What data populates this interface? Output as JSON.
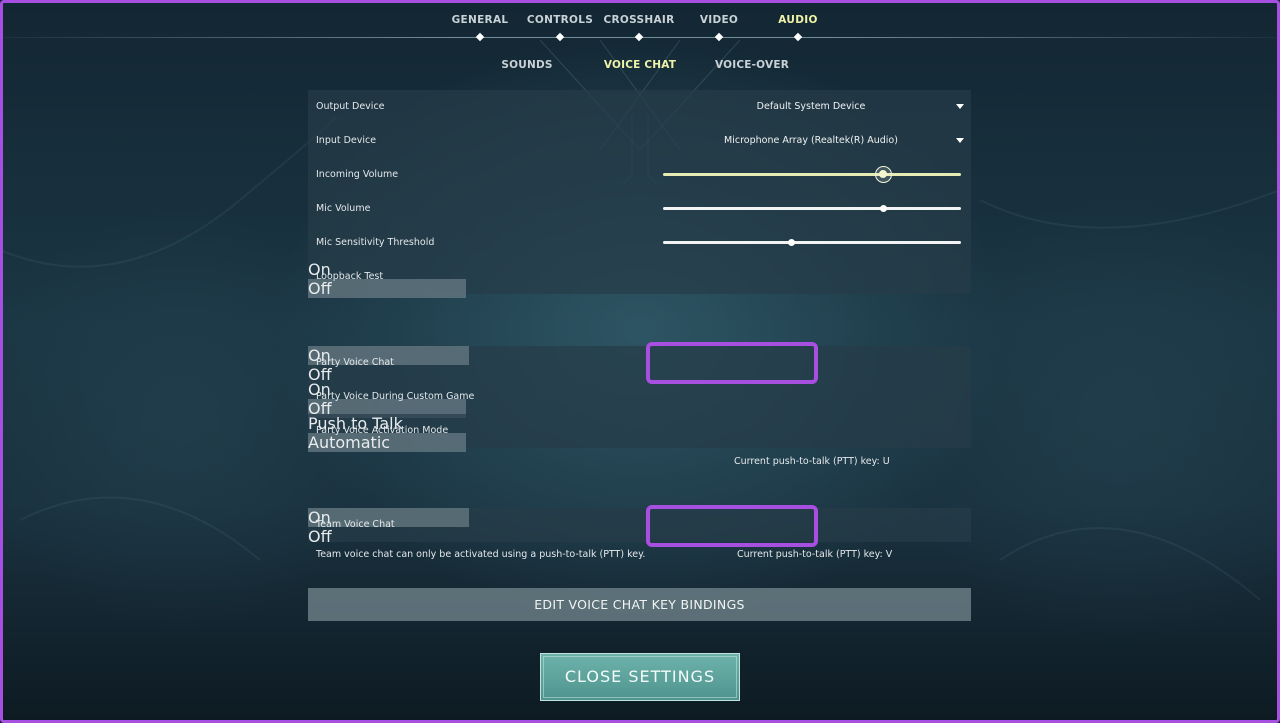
{
  "colors": {
    "accent": "#eef3a8",
    "highlight": "#a64fe0",
    "close_button": "#5fa49d"
  },
  "top_tabs": [
    {
      "label": "GENERAL"
    },
    {
      "label": "CONTROLS"
    },
    {
      "label": "CROSSHAIR"
    },
    {
      "label": "VIDEO"
    },
    {
      "label": "AUDIO",
      "active": true
    }
  ],
  "sub_tabs": [
    {
      "label": "SOUNDS"
    },
    {
      "label": "VOICE CHAT",
      "active": true
    },
    {
      "label": "VOICE-OVER"
    }
  ],
  "settings": {
    "output_device": {
      "label": "Output Device",
      "value": "Default System Device"
    },
    "input_device": {
      "label": "Input Device",
      "value": "Microphone Array (Realtek(R) Audio)"
    },
    "incoming_volume": {
      "label": "Incoming Volume",
      "level": 0.74
    },
    "mic_volume": {
      "label": "Mic Volume",
      "level": 0.74
    },
    "mic_sensitivity": {
      "label": "Mic Sensitivity Threshold",
      "level": 0.43
    },
    "loopback_test": {
      "label": "Loopback Test",
      "options": [
        "On",
        "Off"
      ],
      "selected": "Off"
    },
    "party_voice_chat": {
      "label": "Party Voice Chat",
      "options": [
        "On",
        "Off"
      ],
      "selected": "On"
    },
    "party_voice_custom": {
      "label": "Party Voice During Custom Game",
      "options": [
        "On",
        "Off"
      ],
      "selected": "Off"
    },
    "party_voice_mode": {
      "label": "Party Voice Activation Mode",
      "options": [
        "Push to Talk",
        "Automatic"
      ],
      "selected": "Automatic"
    },
    "party_ptt_note": "Current push-to-talk (PTT) key: U",
    "team_voice_chat": {
      "label": "Team Voice Chat",
      "options": [
        "On",
        "Off"
      ],
      "selected": "On"
    },
    "team_note": "Team voice chat can only be activated using a push-to-talk (PTT) key.",
    "team_ptt_note": "Current push-to-talk (PTT) key: V"
  },
  "buttons": {
    "edit_bindings": "EDIT VOICE CHAT KEY BINDINGS",
    "close_settings": "CLOSE SETTINGS"
  }
}
